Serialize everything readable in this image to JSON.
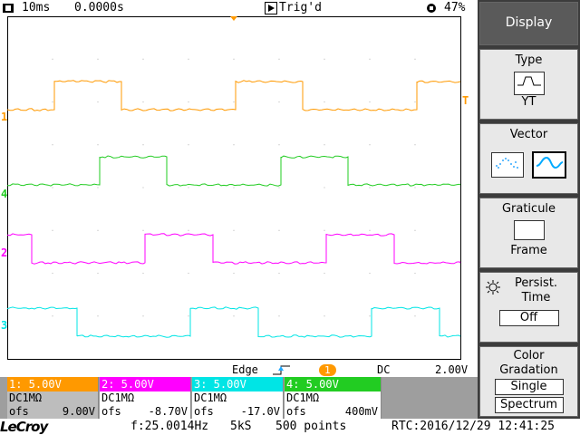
{
  "status": {
    "timebase": "10ms",
    "delay": "0.0000s",
    "trigger_state": "Trig'd",
    "battery": "47%"
  },
  "trigger": {
    "mode": "Edge",
    "level_badge": "1",
    "coupling": "DC",
    "level": "2.00V"
  },
  "channels": [
    {
      "hdr": "1: 5.00V",
      "coupling": "DC1MΩ",
      "ofs_label": "ofs",
      "ofs": "9.00V",
      "color": "#ff9900"
    },
    {
      "hdr": "2: 5.00V",
      "coupling": "DC1MΩ",
      "ofs_label": "ofs",
      "ofs": "-8.70V",
      "color": "#ff00ff"
    },
    {
      "hdr": "3: 5.00V",
      "coupling": "DC1MΩ",
      "ofs_label": "ofs",
      "ofs": "-17.0V",
      "color": "#00e5e5"
    },
    {
      "hdr": "4: 5.00V",
      "coupling": "DC1MΩ",
      "ofs_label": "ofs",
      "ofs": "400mV",
      "color": "#22cc22"
    }
  ],
  "trace_labels": [
    "1",
    "4",
    "2",
    "3"
  ],
  "trigger_marker": "T",
  "bottom": {
    "logo": "LeCroy",
    "freq": "f:25.0014Hz",
    "samplerate": "5kS",
    "points": "500 points",
    "rtc": "RTC:2016/12/29 12:41:25"
  },
  "menu": {
    "display": "Display",
    "type_title": "Type",
    "type_value": "YT",
    "vector_title": "Vector",
    "graticule_title": "Graticule",
    "graticule_value": "Frame",
    "persist_title_1": "Persist.",
    "persist_title_2": "Time",
    "persist_value": "Off",
    "color_title_1": "Color",
    "color_title_2": "Gradation",
    "color_opt_1": "Single",
    "color_opt_2": "Spectrum"
  },
  "colors": {
    "ch1": "#ff9900",
    "ch2": "#ff00ff",
    "ch3": "#00e5e5",
    "ch4": "#22cc22",
    "grid": "#000000"
  }
}
